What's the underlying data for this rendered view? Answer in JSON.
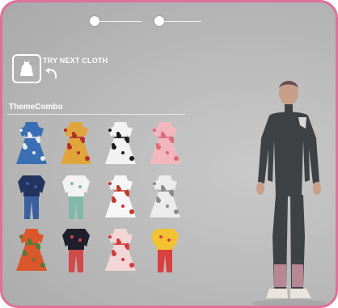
{
  "header": {
    "try_next_label": "TRY NEXT CLOTH",
    "icons": [
      "dress-icon",
      "undo-arrow-icon"
    ]
  },
  "progress": {
    "steps": 2,
    "current_step": 2
  },
  "catalog": {
    "title": "ThemeCombo",
    "items": [
      {
        "name": "blue-floral-dress",
        "type": "dress",
        "colors": [
          "#3a6fb3",
          "#e8ecf5"
        ]
      },
      {
        "name": "yellow-red-pattern-dress",
        "type": "dress",
        "colors": [
          "#e0a53a",
          "#b32d2d"
        ]
      },
      {
        "name": "black-white-print-dress",
        "type": "dress",
        "colors": [
          "#f2f2f2",
          "#1a1a1a"
        ]
      },
      {
        "name": "pink-floral-dress",
        "type": "dress",
        "colors": [
          "#f2b6be",
          "#e06874"
        ]
      },
      {
        "name": "navy-top-jeans-outfit",
        "type": "outfit",
        "colors": [
          "#23355f",
          "#3b5fa3"
        ]
      },
      {
        "name": "white-top-green-pants-outfit",
        "type": "outfit",
        "colors": [
          "#f2f2f2",
          "#7fb9a8"
        ]
      },
      {
        "name": "white-red-print-dress",
        "type": "dress",
        "colors": [
          "#f6f6f6",
          "#c0392b"
        ]
      },
      {
        "name": "grey-floral-dress",
        "type": "dress",
        "colors": [
          "#ececec",
          "#8a8a8a"
        ]
      },
      {
        "name": "orange-floral-dress",
        "type": "dress",
        "colors": [
          "#d9572a",
          "#4f7d3a"
        ]
      },
      {
        "name": "black-jacket-red-dress",
        "type": "outfit",
        "colors": [
          "#1f1f2b",
          "#d04a4a"
        ]
      },
      {
        "name": "pink-red-floral-dress",
        "type": "dress",
        "colors": [
          "#f3d6d6",
          "#d23a3a"
        ]
      },
      {
        "name": "multicolor-top-outfit",
        "type": "outfit",
        "colors": [
          "#f2c230",
          "#d94040"
        ]
      }
    ]
  },
  "avatar": {
    "suit_color": "#3f4245",
    "accent_color": "#d69aa6",
    "skin_color": "#c89f88",
    "shoe_color": "#e9e4dc"
  },
  "colors": {
    "frame_border": "#e0709a",
    "background": "#bdbdbd",
    "text": "#ffffff"
  }
}
